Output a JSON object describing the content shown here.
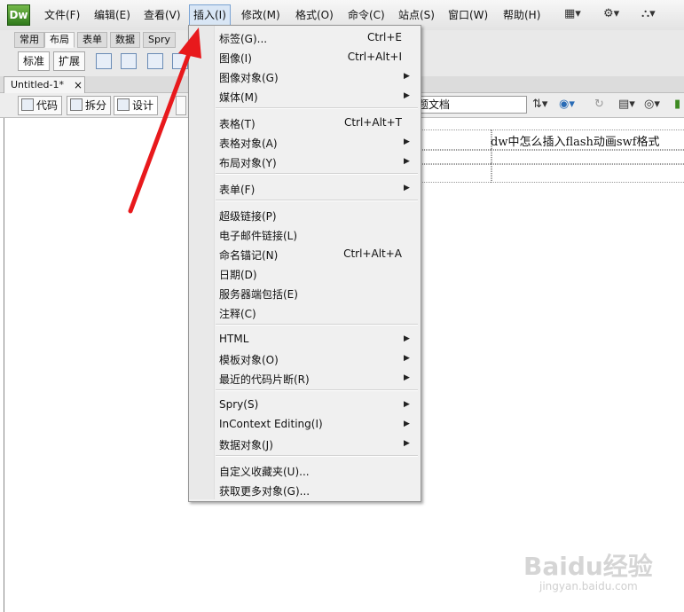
{
  "app": {
    "logo": "Dw"
  },
  "menubar": {
    "items": [
      "文件(F)",
      "编辑(E)",
      "查看(V)",
      "插入(I)",
      "修改(M)",
      "格式(O)",
      "命令(C)",
      "站点(S)",
      "窗口(W)",
      "帮助(H)"
    ],
    "active": "插入(I)",
    "icons": [
      "layout-icon",
      "gear-icon",
      "site-icon"
    ]
  },
  "insert_bar": {
    "tabs": [
      "常用",
      "布局",
      "表单",
      "数据",
      "Spry"
    ],
    "active_tab": "布局",
    "mode_buttons": [
      "标准",
      "扩展"
    ]
  },
  "document": {
    "tab_title": "Untitled-1*",
    "close_glyph": "×",
    "view_buttons": [
      "代码",
      "拆分",
      "设计"
    ],
    "title_field_value": "题文档",
    "cell_text": "dw中怎么插入flash动画swf格式"
  },
  "insert_menu": {
    "groups": [
      [
        {
          "label": "标签(G)...",
          "shortcut": "Ctrl+E",
          "submenu": false
        },
        {
          "label": "图像(I)",
          "shortcut": "Ctrl+Alt+I",
          "submenu": false
        },
        {
          "label": "图像对象(G)",
          "shortcut": "",
          "submenu": true
        },
        {
          "label": "媒体(M)",
          "shortcut": "",
          "submenu": true
        }
      ],
      [
        {
          "label": "表格(T)",
          "shortcut": "Ctrl+Alt+T",
          "submenu": false
        },
        {
          "label": "表格对象(A)",
          "shortcut": "",
          "submenu": true
        },
        {
          "label": "布局对象(Y)",
          "shortcut": "",
          "submenu": true
        }
      ],
      [
        {
          "label": "表单(F)",
          "shortcut": "",
          "submenu": true
        }
      ],
      [
        {
          "label": "超级链接(P)",
          "shortcut": "",
          "submenu": false
        },
        {
          "label": "电子邮件链接(L)",
          "shortcut": "",
          "submenu": false
        },
        {
          "label": "命名锚记(N)",
          "shortcut": "Ctrl+Alt+A",
          "submenu": false
        },
        {
          "label": "日期(D)",
          "shortcut": "",
          "submenu": false
        },
        {
          "label": "服务器端包括(E)",
          "shortcut": "",
          "submenu": false
        },
        {
          "label": "注释(C)",
          "shortcut": "",
          "submenu": false
        }
      ],
      [
        {
          "label": "HTML",
          "shortcut": "",
          "submenu": true
        },
        {
          "label": "模板对象(O)",
          "shortcut": "",
          "submenu": true
        },
        {
          "label": "最近的代码片断(R)",
          "shortcut": "",
          "submenu": true
        }
      ],
      [
        {
          "label": "Spry(S)",
          "shortcut": "",
          "submenu": true
        },
        {
          "label": "InContext Editing(I)",
          "shortcut": "",
          "submenu": true
        },
        {
          "label": "数据对象(J)",
          "shortcut": "",
          "submenu": true
        }
      ],
      [
        {
          "label": "自定义收藏夹(U)...",
          "shortcut": "",
          "submenu": false
        },
        {
          "label": "获取更多对象(G)...",
          "shortcut": "",
          "submenu": false
        }
      ]
    ]
  },
  "watermark": {
    "brand": "Baidu经验",
    "url": "jingyan.baidu.com"
  },
  "colors": {
    "annotation_arrow": "#e8191c",
    "logo_green": "#3d8a22",
    "menu_highlight": "#d9e6f5"
  }
}
